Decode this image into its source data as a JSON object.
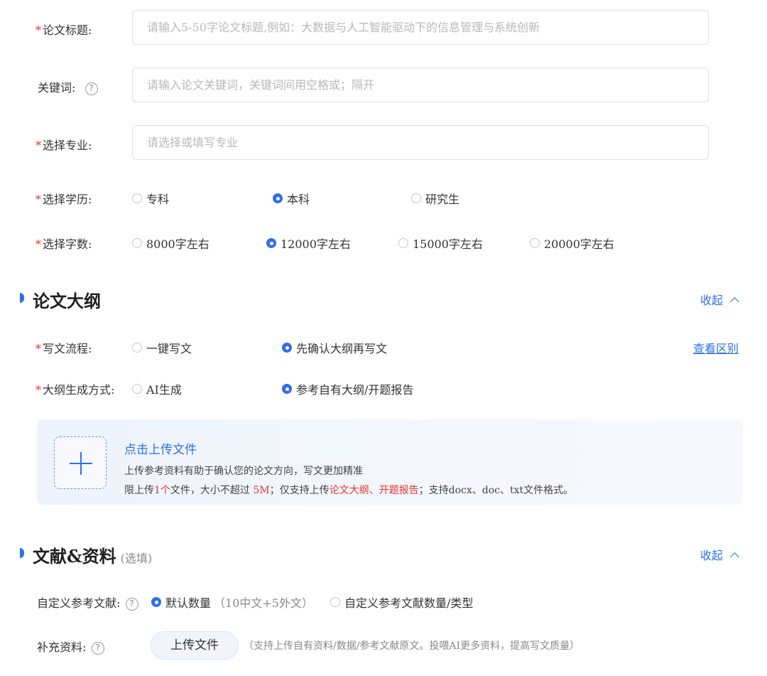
{
  "paper_title": {
    "label": "论文标题:",
    "placeholder": "请输入5-50字论文标题,例如：大数据与人工智能驱动下的信息管理与系统创新"
  },
  "keywords": {
    "label": "关键词:",
    "placeholder": "请输入论文关键词，关键词间用空格或；隔开"
  },
  "major": {
    "label": "选择专业:",
    "placeholder": "请选择或填写专业"
  },
  "education": {
    "label": "选择学历:",
    "options": [
      "专科",
      "本科",
      "研究生"
    ],
    "selected": "本科"
  },
  "word_count": {
    "label": "选择字数:",
    "options": [
      "8000字左右",
      "12000字左右",
      "15000字左右",
      "20000字左右"
    ],
    "selected": "12000字左右"
  },
  "outline_section": {
    "title": "论文大纲",
    "collapse_label": "收起",
    "process": {
      "label": "写文流程:",
      "options": [
        "一键写文",
        "先确认大纲再写文"
      ],
      "selected": "先确认大纲再写文",
      "link": "查看区别"
    },
    "generation": {
      "label": "大纲生成方式:",
      "options": [
        "AI生成",
        "参考自有大纲/开题报告"
      ],
      "selected": "参考自有大纲/开题报告"
    },
    "upload": {
      "title": "点击上传文件",
      "desc": "上传参考资料有助于确认您的论文方向，写文更加精准",
      "limit_prefix": "限上传",
      "limit_count": "1个",
      "limit_mid": "文件，大小不超过 ",
      "limit_size": "5M",
      "limit_mid2": "；仅支持上传",
      "limit_types": "论文大纲、开题报告",
      "limit_suffix": "；支持docx、doc、txt文件格式。"
    }
  },
  "refs_section": {
    "title": "文献&资料",
    "optional": "(选填)",
    "collapse_label": "收起",
    "custom_refs": {
      "label": "自定义参考文献:",
      "options": [
        "默认数量",
        "自定义参考文献数量/类型"
      ],
      "default_hint": "（10中文+5外文）",
      "selected": "默认数量"
    },
    "supplement": {
      "label": "补充资料:",
      "button": "上传文件",
      "hint": "（支持上传自有资料/数据/参考文献原文。投喂AI更多资料，提高写文质量）"
    }
  },
  "colors": {
    "accent": "#2f6fe8",
    "required": "#e8352e"
  },
  "icons": [
    "help-circle-icon",
    "chevron-up-icon",
    "plus-icon"
  ]
}
